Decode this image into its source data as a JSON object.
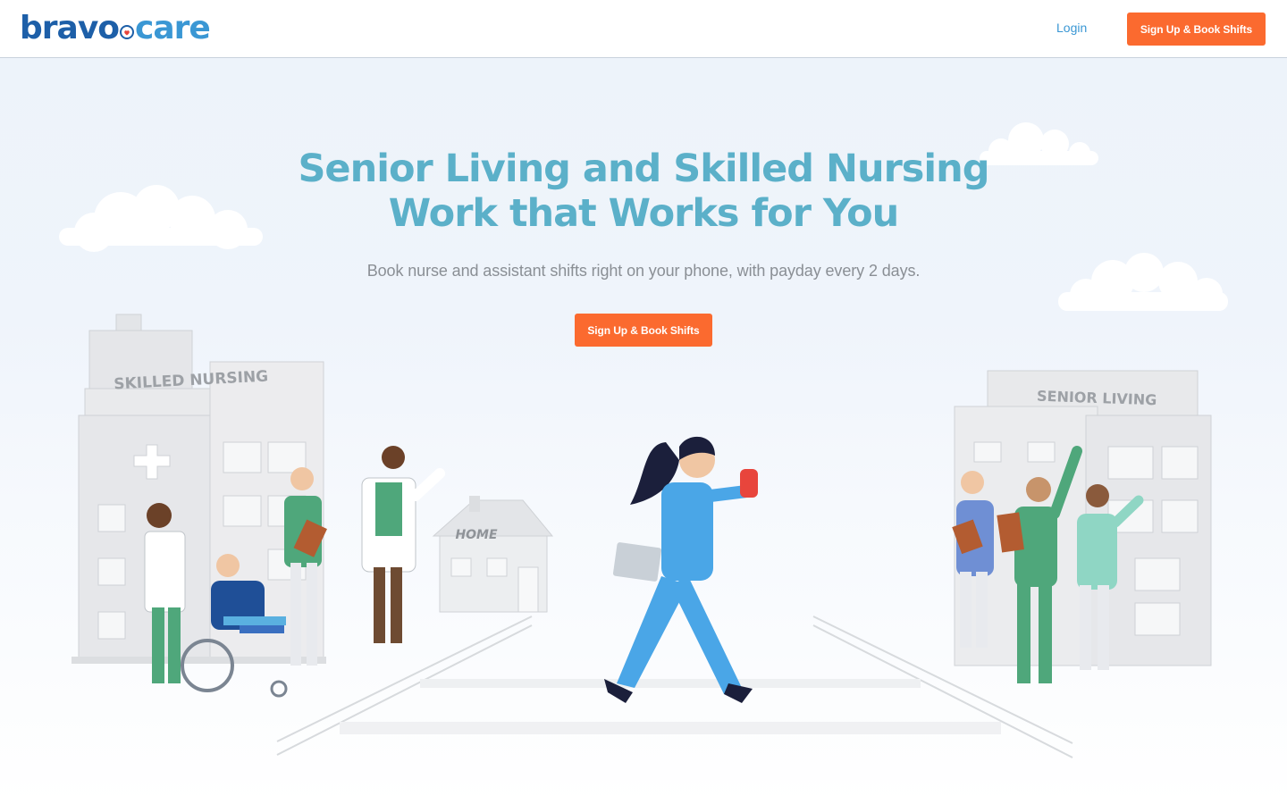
{
  "header": {
    "logo": {
      "part_a": "bravo",
      "part_b": "care"
    },
    "login_label": "Login",
    "cta_label": "Sign Up & Book Shifts"
  },
  "hero": {
    "headline_line1": "Senior Living and Skilled Nursing",
    "headline_line2": "Work that Works for You",
    "subheadline": "Book nurse and assistant shifts right on your phone, with payday every 2 days.",
    "cta_label": "Sign Up & Book Shifts",
    "illustration": {
      "left_building_sign": "SKILLED NURSING",
      "center_house_sign": "HOME",
      "right_building_sign": "SENIOR LIVING"
    }
  },
  "colors": {
    "brand_dark_blue": "#1d5fa8",
    "brand_light_blue": "#3a97d4",
    "headline_teal": "#5bb0c9",
    "cta_orange": "#fb6a2f",
    "subhead_gray": "#8a8f95"
  },
  "icons": {
    "logo_mark": "heart-pin-icon",
    "hero_art": "healthcare-workers-illustration"
  }
}
